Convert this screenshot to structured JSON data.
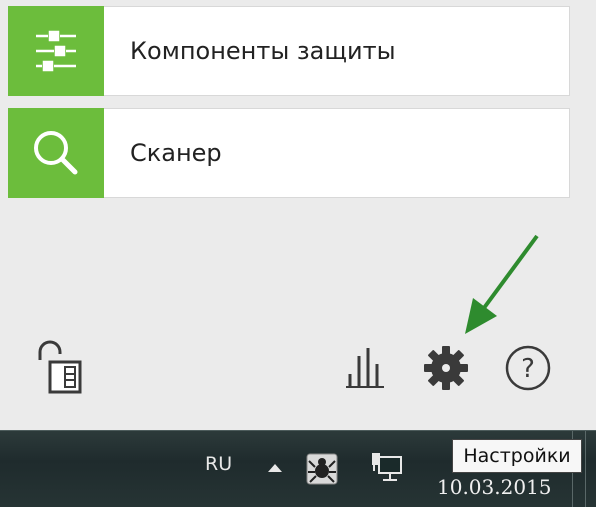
{
  "menu": {
    "items": [
      {
        "label": "Компоненты защиты",
        "icon": "sliders-icon"
      },
      {
        "label": "Сканер",
        "icon": "search-icon"
      }
    ]
  },
  "toolbar": {
    "lock_icon": "unlocked-padlock-icon",
    "stats_icon": "bar-chart-icon",
    "settings_icon": "gear-icon",
    "help_icon": "help-circle-icon",
    "help_glyph": "?"
  },
  "tooltip": {
    "text": "Настройки"
  },
  "taskbar": {
    "language": "RU",
    "date": "10.03.2015"
  },
  "colors": {
    "accent_green": "#6cbd3c",
    "arrow_green": "#2e8b2e",
    "icon_gray": "#3a3a3a"
  }
}
